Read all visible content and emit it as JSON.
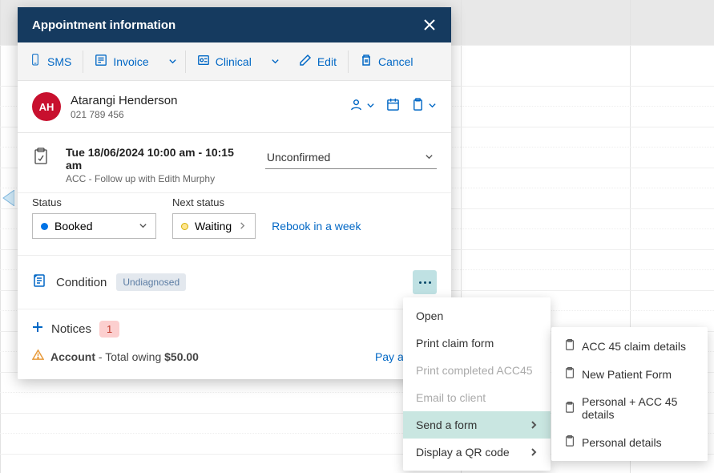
{
  "panel": {
    "title": "Appointment information"
  },
  "toolbar": {
    "sms": "SMS",
    "invoice": "Invoice",
    "clinical": "Clinical",
    "edit": "Edit",
    "cancel": "Cancel"
  },
  "patient": {
    "initials": "AH",
    "name": "Atarangi Henderson",
    "phone": "021 789 456"
  },
  "appointment": {
    "datetime": "Tue 18/06/2024 10:00 am - 10:15 am",
    "description": "ACC - Follow up with Edith Murphy",
    "confirm_state": "Unconfirmed"
  },
  "status": {
    "label": "Status",
    "next_label": "Next status",
    "current": "Booked",
    "next": "Waiting",
    "rebook": "Rebook in a week"
  },
  "condition": {
    "label": "Condition",
    "badge": "Undiagnosed"
  },
  "notices": {
    "label": "Notices",
    "count": "1"
  },
  "account": {
    "label": "Account",
    "owing_prefix": " - Total owing ",
    "owing_amount": "$50.00",
    "pay_link": "Pay account"
  },
  "menu1": {
    "open": "Open",
    "print_claim": "Print claim form",
    "print_acc45": "Print completed ACC45",
    "email": "Email to client",
    "send_form": "Send a form",
    "qr": "Display a QR code"
  },
  "menu2": {
    "acc45": "ACC 45 claim details",
    "new_patient": "New Patient Form",
    "personal_acc45": "Personal + ACC 45 details",
    "personal": "Personal details"
  }
}
